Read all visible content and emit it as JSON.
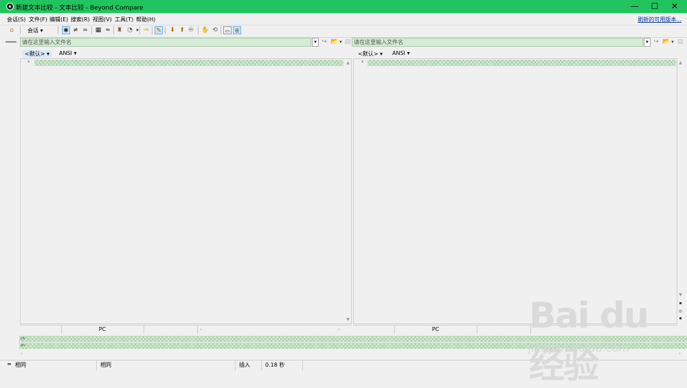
{
  "window": {
    "title": "新建文本比较 - 文本比较 - Beyond Compare",
    "controls": {
      "minimize": "—",
      "maximize": "☐",
      "close": "✕"
    }
  },
  "menu": {
    "items": [
      "会话(S)",
      "文件(F)",
      "编辑(E)",
      "搜索(R)",
      "视图(V)",
      "工具(T)",
      "帮助(H)"
    ],
    "update_link": "刷新的可用版本..."
  },
  "toolbar": {
    "session_label": "会话",
    "icons": [
      "home-icon",
      "all-icon",
      "diffs-icon",
      "same-icon",
      "rules-icon",
      "ignore-icon",
      "format-icon",
      "copy-icon",
      "swap-icon",
      "edit-icon",
      "prev-diff-icon",
      "next-diff-icon",
      "find-icon",
      "stop-icon",
      "reload-icon",
      "compact-icon",
      "details-icon"
    ]
  },
  "left_panel": {
    "path_placeholder": "请在这里输入文件名",
    "format_label": "<默认>",
    "encoding_label": "ANSI",
    "line_ending": "PC"
  },
  "right_panel": {
    "path_placeholder": "请在这里输入文件名",
    "format_label": "<默认>",
    "encoding_label": "ANSI",
    "line_ending": "PC"
  },
  "status": {
    "icon": "equal-icon",
    "left_text": "相同",
    "middle_text": "相同",
    "mode": "插入",
    "time": "0.18 秒"
  },
  "watermark": {
    "logo": "Bai du 经验",
    "url": "jingyan.baidu.com"
  }
}
